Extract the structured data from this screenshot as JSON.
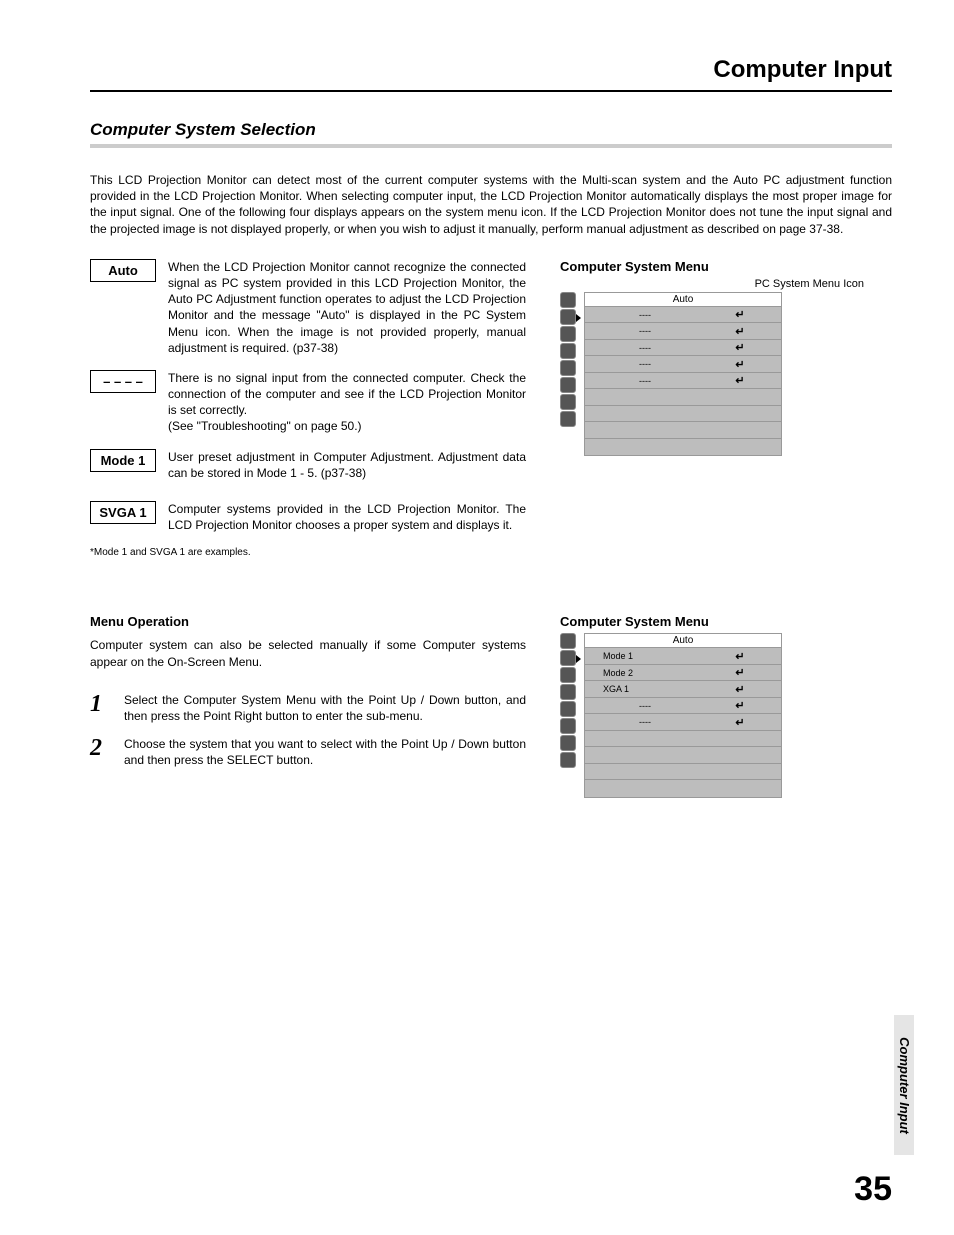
{
  "header": {
    "title": "Computer Input"
  },
  "section_title": "Computer System Selection",
  "intro": "This LCD Projection Monitor can detect most of the current computer systems with the Multi-scan system and the Auto PC adjustment function provided in the LCD Projection Monitor.  When selecting computer input, the LCD Projection Monitor automatically displays the most proper image for the input signal.  One of the following four displays appears on the system menu icon.  If the LCD Projection Monitor does not tune the input signal and the projected image is not displayed properly, or when you wish to adjust it manually, perform manual adjustment as described on page 37-38.",
  "modes": [
    {
      "label": "Auto",
      "text": "When the LCD Projection Monitor cannot recognize the connected signal as PC system provided in this LCD Projection Monitor, the Auto PC Adjustment function operates to adjust the LCD Projection Monitor and the message \"Auto\" is displayed in the PC System Menu icon.  When the image is not provided properly, manual adjustment is required.  (p37-38)"
    },
    {
      "label": "– – – –",
      "text": "There is no signal input from the connected computer.  Check the connection of the computer and see if the LCD Projection Monitor is set correctly.\n(See \"Troubleshooting\" on page 50.)"
    },
    {
      "label": "Mode 1",
      "text": "User preset adjustment in Computer Adjustment.  Adjustment data can be stored in Mode 1 - 5.  (p37-38)"
    },
    {
      "label": "SVGA 1",
      "text": "Computer systems provided in the LCD Projection Monitor.  The LCD Projection Monitor chooses a proper system and displays it."
    }
  ],
  "footnote": "*Mode 1 and SVGA 1 are examples.",
  "menu1": {
    "heading": "Computer System Menu",
    "caption": "PC System Menu Icon",
    "header": "Auto",
    "rows": [
      {
        "label": "----",
        "enter": true
      },
      {
        "label": "----",
        "enter": true
      },
      {
        "label": "----",
        "enter": true
      },
      {
        "label": "----",
        "enter": true
      },
      {
        "label": "----",
        "enter": true
      },
      {
        "label": "",
        "enter": false
      },
      {
        "label": "",
        "enter": false
      },
      {
        "label": "",
        "enter": false
      },
      {
        "label": "",
        "enter": false
      }
    ]
  },
  "menu_op": {
    "heading": "Menu Operation",
    "text": "Computer system can also be selected manually if some Computer systems appear on the On-Screen Menu.",
    "steps": [
      {
        "num": "1",
        "text": "Select the Computer System Menu with the Point Up / Down button, and then press the Point Right button to enter the sub-menu."
      },
      {
        "num": "2",
        "text": "Choose the system that you want to select with the Point Up / Down button and then press the SELECT button."
      }
    ]
  },
  "menu2": {
    "heading": "Computer System Menu",
    "header": "Auto",
    "rows": [
      {
        "label": "Mode 1",
        "enter": true
      },
      {
        "label": "Mode 2",
        "enter": true
      },
      {
        "label": "XGA 1",
        "enter": true
      },
      {
        "label": "----",
        "enter": true
      },
      {
        "label": "----",
        "enter": true
      },
      {
        "label": "",
        "enter": false
      },
      {
        "label": "",
        "enter": false
      },
      {
        "label": "",
        "enter": false
      },
      {
        "label": "",
        "enter": false
      }
    ]
  },
  "side_tab": "Computer Input",
  "page_number": "35",
  "enter_symbol": "↵"
}
